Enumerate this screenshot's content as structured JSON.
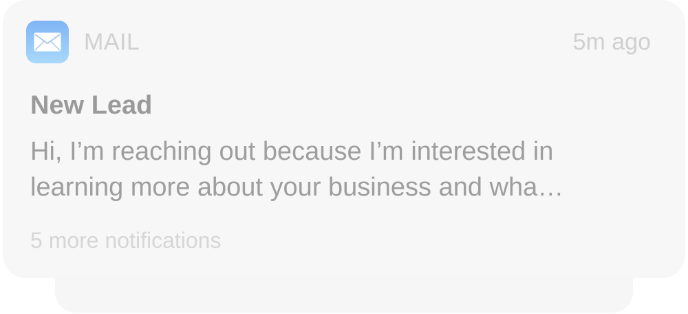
{
  "notification": {
    "app_name": "MAIL",
    "app_icon": "envelope-icon",
    "time": "5m ago",
    "title": "New Lead",
    "body_line1": "Hi, I’m reaching out because I’m interested in",
    "body_line2": "learning more about your business and wha…",
    "more": "5 more notifications"
  },
  "colors": {
    "icon_gradient_top": "#7fb4f5",
    "icon_gradient_bottom": "#a9d9fb",
    "card_background": "#f7f7f7"
  }
}
